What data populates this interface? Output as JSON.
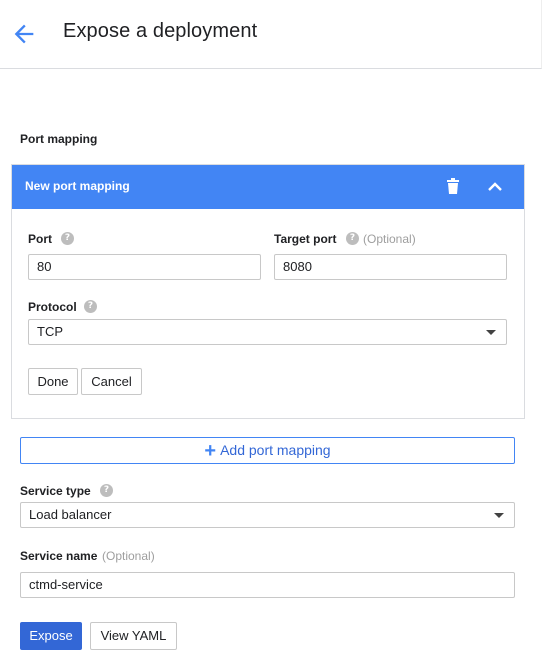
{
  "header": {
    "title": "Expose a deployment",
    "back_icon": "arrow-back-icon"
  },
  "port_mapping": {
    "section_label": "Port mapping",
    "panel_title": "New port mapping",
    "port": {
      "label": "Port",
      "value": "80"
    },
    "target_port": {
      "label": "Target port",
      "optional": "(Optional)",
      "value": "8080"
    },
    "protocol": {
      "label": "Protocol",
      "value": "TCP"
    },
    "done_label": "Done",
    "cancel_label": "Cancel"
  },
  "add_port_mapping": {
    "plus": "+",
    "label": "Add port mapping"
  },
  "service_type": {
    "label": "Service type",
    "value": "Load balancer"
  },
  "service_name": {
    "label": "Service name",
    "optional": "(Optional)",
    "value": "ctmd-service"
  },
  "actions": {
    "expose_label": "Expose",
    "view_yaml_label": "View YAML"
  },
  "help_glyph": "?",
  "colors": {
    "accent": "#4285f4",
    "primary_button": "#3367d6"
  }
}
